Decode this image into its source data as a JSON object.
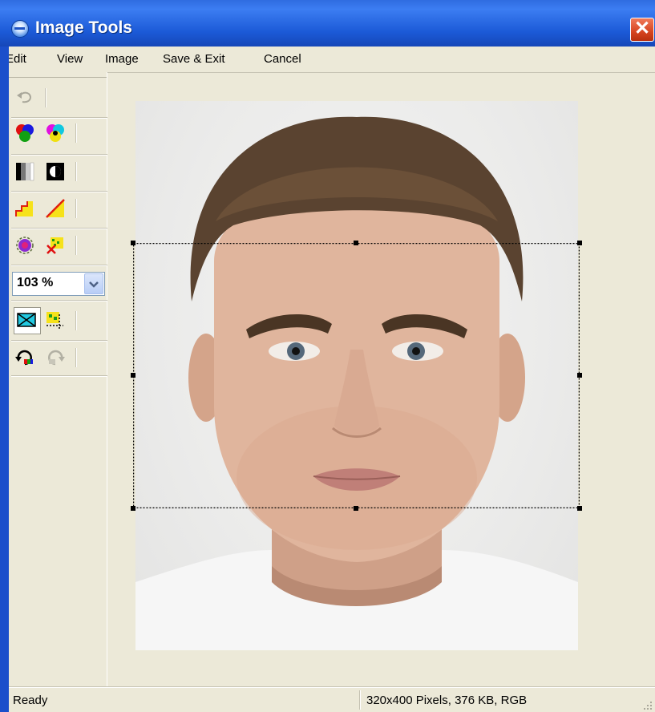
{
  "window": {
    "title": "Image Tools"
  },
  "icons": {
    "app": "app-globe-icon",
    "close": "close-icon",
    "undo": "undo-icon",
    "color_balance": "rgb-color-balance-icon",
    "color_adjust": "cmy-color-adjust-icon",
    "grayscale": "grayscale-icon",
    "invert": "invert-icon",
    "brightness": "brightness-icon",
    "contrast": "contrast-icon",
    "red_eye": "red-eye-icon",
    "remove_noise": "remove-noise-icon",
    "select_crop": "select-crop-icon",
    "crop_apply": "crop-apply-icon",
    "rotate_left": "rotate-left-icon",
    "rotate_right": "rotate-right-icon",
    "dropdown": "chevron-down-icon",
    "resize_grip": "resize-grip-icon"
  },
  "menu": [
    {
      "label": "Edit"
    },
    {
      "label": "View"
    },
    {
      "label": "Image"
    },
    {
      "label": "Save & Exit"
    },
    {
      "label": "Cancel"
    }
  ],
  "toolbar": {
    "zoom_value": "103 %"
  },
  "statusbar": {
    "left": "Ready",
    "right": "320x400 Pixels, 376 KB, RGB"
  },
  "colors": {
    "title_bar": "#1b59d6",
    "window_bg": "#ece9d8",
    "close_button": "#d6441f"
  }
}
